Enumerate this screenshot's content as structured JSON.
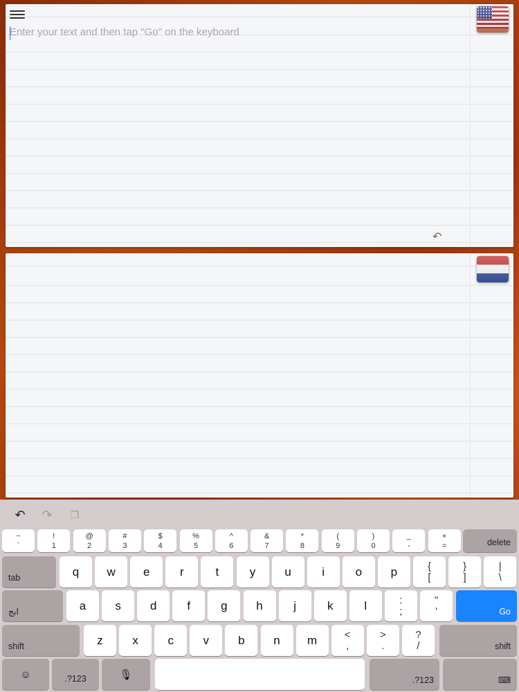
{
  "editor": {
    "placeholder": "Enter your text and then tap \"Go\" on the keyboard",
    "source_flag": "us-flag-icon",
    "target_flag": "netherlands-flag-icon"
  },
  "keyboard": {
    "number_row": [
      {
        "top": "~",
        "bottom": "`"
      },
      {
        "top": "!",
        "bottom": "1"
      },
      {
        "top": "@",
        "bottom": "2"
      },
      {
        "top": "#",
        "bottom": "3"
      },
      {
        "top": "$",
        "bottom": "4"
      },
      {
        "top": "%",
        "bottom": "5"
      },
      {
        "top": "^",
        "bottom": "6"
      },
      {
        "top": "&",
        "bottom": "7"
      },
      {
        "top": "*",
        "bottom": "8"
      },
      {
        "top": "(",
        "bottom": "9"
      },
      {
        "top": ")",
        "bottom": "0"
      },
      {
        "top": "_",
        "bottom": "-"
      },
      {
        "top": "+",
        "bottom": "="
      }
    ],
    "delete_label": "delete",
    "tab_label": "tab",
    "row_q": [
      "q",
      "w",
      "e",
      "r",
      "t",
      "y",
      "u",
      "i",
      "o",
      "p"
    ],
    "row_q_symbols": [
      {
        "top": "{",
        "bottom": "["
      },
      {
        "top": "}",
        "bottom": "]"
      },
      {
        "top": "|",
        "bottom": "\\"
      }
    ],
    "lang_label": "ابج",
    "row_a": [
      "a",
      "s",
      "d",
      "f",
      "g",
      "h",
      "j",
      "k",
      "l"
    ],
    "row_a_symbols": [
      {
        "top": ":",
        "bottom": ";"
      },
      {
        "top": "\"",
        "bottom": "'"
      }
    ],
    "go_label": "Go",
    "shift_label": "shift",
    "row_z": [
      "z",
      "x",
      "c",
      "v",
      "b",
      "n",
      "m"
    ],
    "row_z_symbols": [
      {
        "top": "<",
        "bottom": ","
      },
      {
        "top": ">",
        "bottom": "."
      },
      {
        "top": "?",
        "bottom": "/"
      }
    ],
    "numbers_label": ".?123",
    "accent_color": "#1a84ff"
  }
}
